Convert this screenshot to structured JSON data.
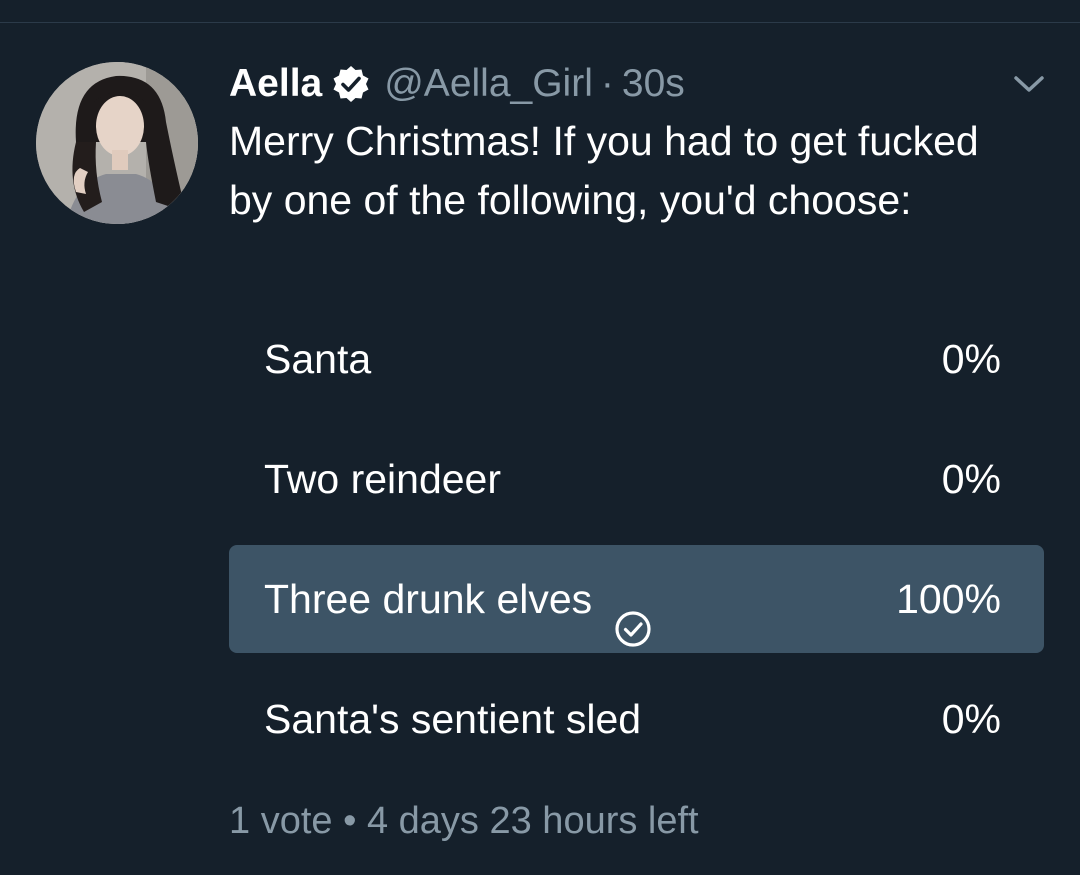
{
  "tweet": {
    "display_name": "Aella",
    "handle": "@Aella_Girl",
    "separator": "·",
    "time": "30s",
    "text": "Merry Christmas! If you had to get fucked by one of the following, you'd choose:"
  },
  "poll": {
    "options": [
      {
        "label": "Santa",
        "percent_text": "0%",
        "percent": 0,
        "selected": false
      },
      {
        "label": "Two reindeer",
        "percent_text": "0%",
        "percent": 0,
        "selected": false
      },
      {
        "label": "Three drunk elves",
        "percent_text": "100%",
        "percent": 100,
        "selected": true
      },
      {
        "label": "Santa's sentient sled",
        "percent_text": "0%",
        "percent": 0,
        "selected": false
      }
    ],
    "votes": "1 vote",
    "footer_separator": "•",
    "time_left": "4 days 23 hours left"
  },
  "icons": {
    "verified": "verified-badge-icon",
    "menu": "chevron-down-icon",
    "selected_option": "check-circle-icon"
  },
  "colors": {
    "background": "#15202b",
    "secondary_text": "#8899a6",
    "poll_bar": "#3d5466",
    "primary_text": "#ffffff"
  }
}
